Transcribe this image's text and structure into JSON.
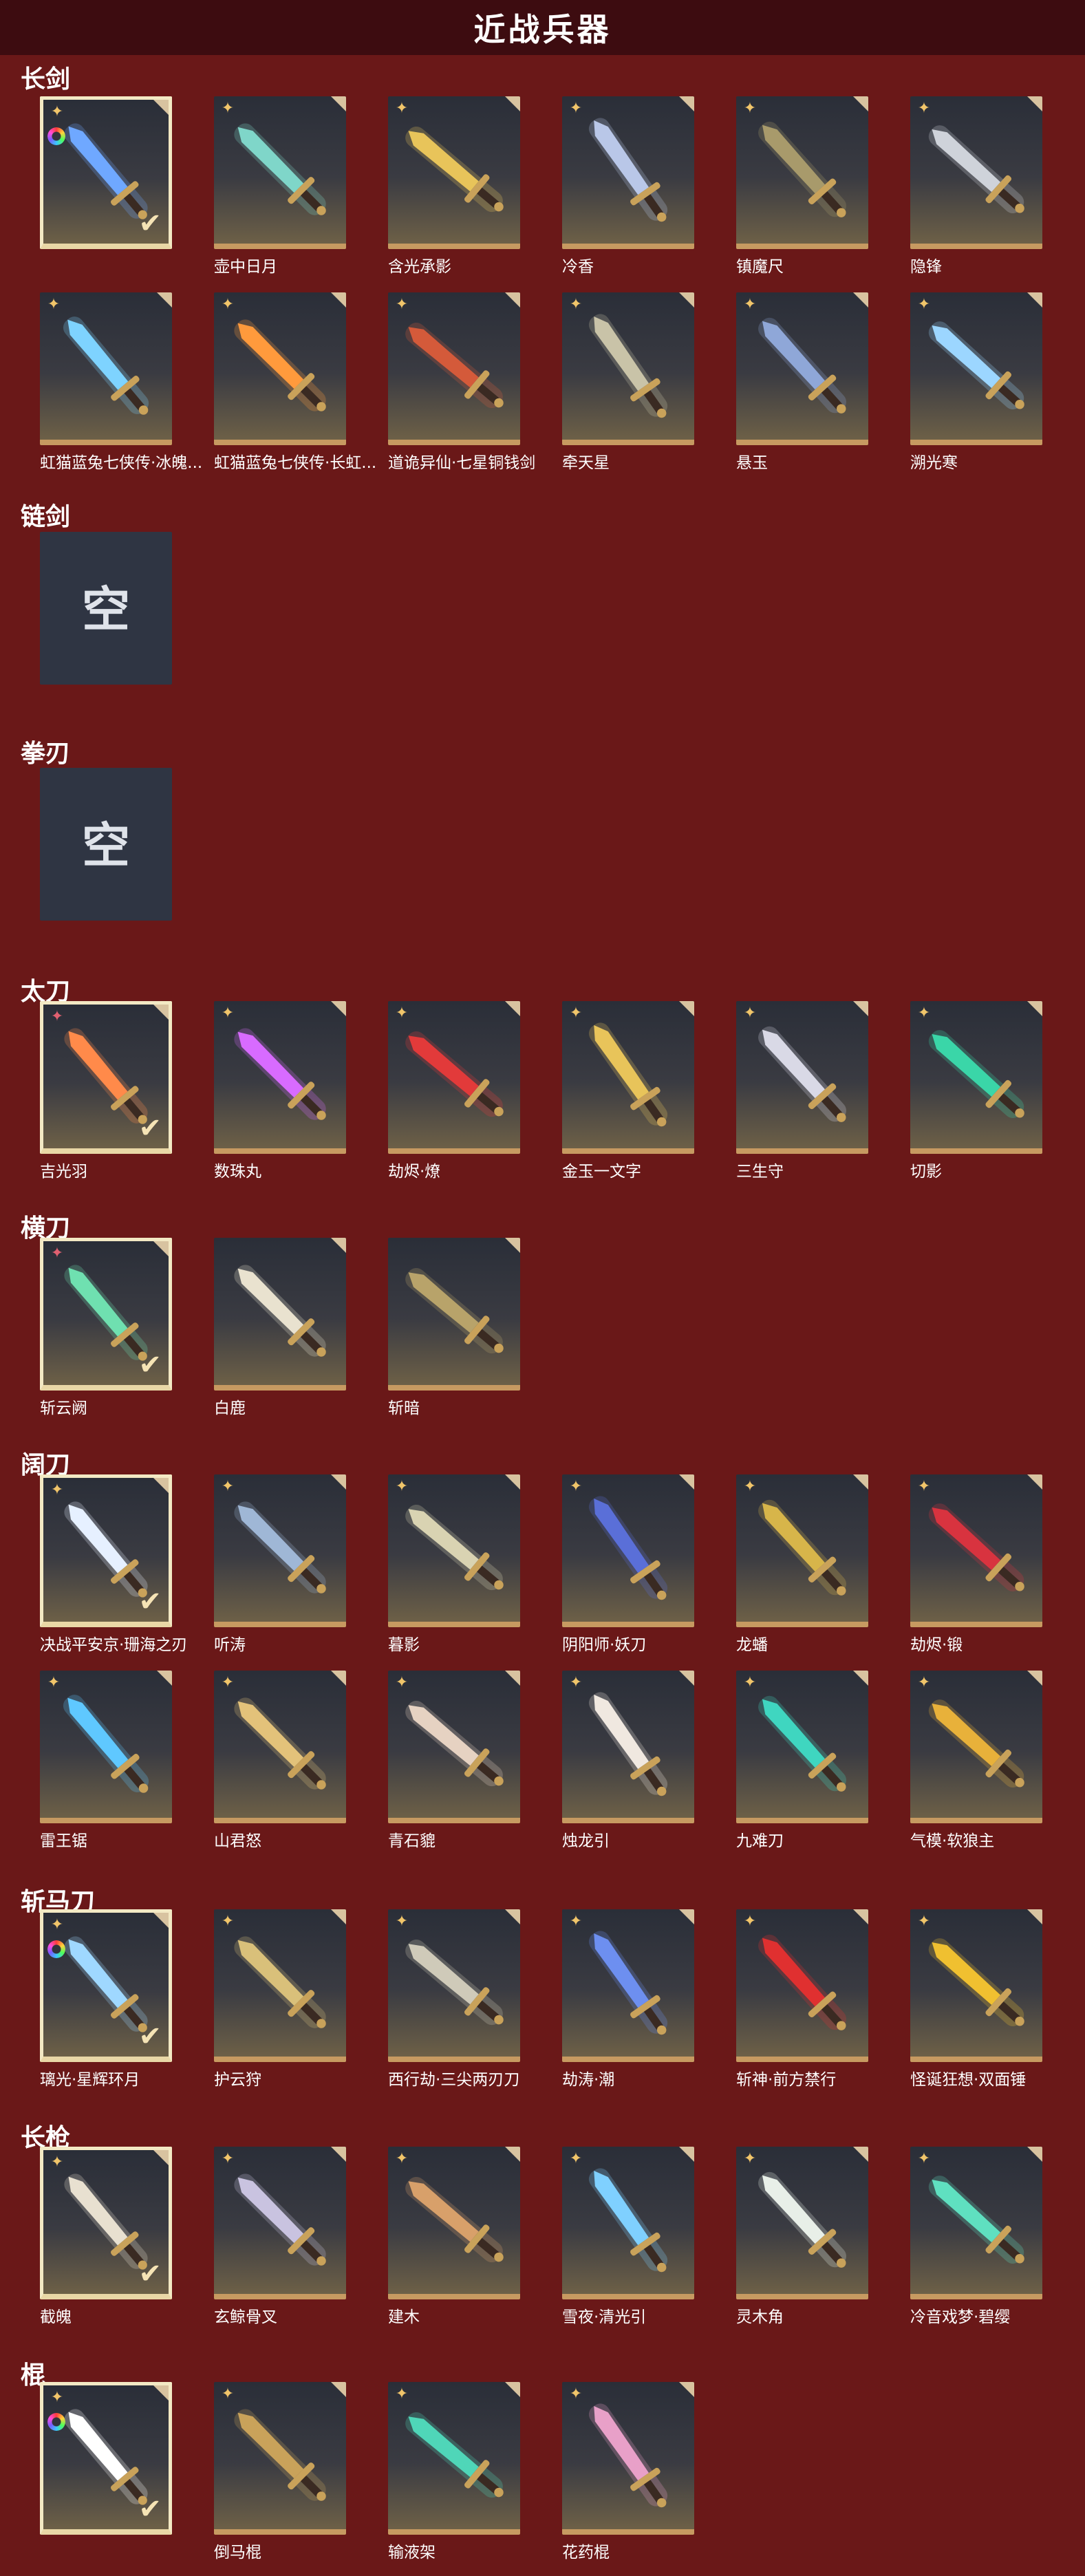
{
  "header": {
    "title": "近战兵器"
  },
  "categories": [
    {
      "title": "长剑",
      "items": [
        {
          "name": "",
          "rarity": "rainbow",
          "selected": true,
          "color": "#6fa8ff"
        },
        {
          "name": "壶中日月",
          "rarity": "gold",
          "color": "#7fd6c9"
        },
        {
          "name": "含光承影",
          "rarity": "gold",
          "color": "#e8c45a"
        },
        {
          "name": "冷香",
          "rarity": "gold",
          "color": "#b9c7e8"
        },
        {
          "name": "镇魔尺",
          "rarity": "gold",
          "color": "#a89a6b"
        },
        {
          "name": "隐锋",
          "rarity": "gold",
          "color": "#cfd3da"
        },
        {
          "name": "虹猫蓝兔七侠传·冰魄...",
          "rarity": "gold",
          "color": "#7ed3ff"
        },
        {
          "name": "虹猫蓝兔七侠传·长虹...",
          "rarity": "gold",
          "color": "#ff9a3c"
        },
        {
          "name": "道诡异仙·七星铜钱剑",
          "rarity": "gold",
          "color": "#d45a3a"
        },
        {
          "name": "牵天星",
          "rarity": "gold",
          "color": "#c9c3a8"
        },
        {
          "name": "悬玉",
          "rarity": "gold",
          "color": "#8fa7d8"
        },
        {
          "name": "溯光寒",
          "rarity": "gold",
          "color": "#9cd6ff"
        }
      ]
    },
    {
      "title": "链剑",
      "items": [
        {
          "name": "",
          "empty": true,
          "empty_label": "空"
        }
      ]
    },
    {
      "title": "拳刃",
      "items": [
        {
          "name": "",
          "empty": true,
          "empty_label": "空"
        }
      ]
    },
    {
      "title": "太刀",
      "items": [
        {
          "name": "吉光羽",
          "rarity": "red",
          "selected": true,
          "color": "#ff8a4a"
        },
        {
          "name": "数珠丸",
          "rarity": "gold",
          "color": "#d86bff"
        },
        {
          "name": "劫烬·燎",
          "rarity": "gold",
          "color": "#e23a3a"
        },
        {
          "name": "金玉一文字",
          "rarity": "gold",
          "color": "#e8c45a"
        },
        {
          "name": "三生守",
          "rarity": "gold",
          "color": "#d9d9e6"
        },
        {
          "name": "切影",
          "rarity": "gold",
          "color": "#3ad6a8"
        }
      ]
    },
    {
      "title": "横刀",
      "items": [
        {
          "name": "斩云阙",
          "rarity": "red",
          "selected": true,
          "color": "#6fe0b0"
        },
        {
          "name": "白鹿",
          "rarity": "none",
          "color": "#e9e2cf"
        },
        {
          "name": "斩暗",
          "rarity": "none",
          "color": "#b8a36a"
        }
      ]
    },
    {
      "title": "阔刀",
      "items": [
        {
          "name": "决战平安京·珊海之刃",
          "rarity": "gold",
          "selected": true,
          "color": "#e6f0ff"
        },
        {
          "name": "听涛",
          "rarity": "gold",
          "color": "#9fb7d6"
        },
        {
          "name": "暮影",
          "rarity": "gold",
          "color": "#d9d3b2"
        },
        {
          "name": "阴阳师·妖刀",
          "rarity": "gold",
          "color": "#5a6fd8"
        },
        {
          "name": "龙蟠",
          "rarity": "gold",
          "color": "#d7b54a"
        },
        {
          "name": "劫烬·锻",
          "rarity": "gold",
          "color": "#d8333f"
        },
        {
          "name": "雷王锯",
          "rarity": "gold",
          "color": "#5fc8ff"
        },
        {
          "name": "山君怒",
          "rarity": "gold",
          "color": "#e3c27a"
        },
        {
          "name": "青石貔",
          "rarity": "gold",
          "color": "#e6d2c2"
        },
        {
          "name": "烛龙引",
          "rarity": "gold",
          "color": "#f0e8e0"
        },
        {
          "name": "九难刀",
          "rarity": "gold",
          "color": "#3fd6c0"
        },
        {
          "name": "气模·软狼主",
          "rarity": "gold",
          "color": "#e8b13a"
        }
      ]
    },
    {
      "title": "斩马刀",
      "items": [
        {
          "name": "璃光·星辉环月",
          "rarity": "rainbow",
          "selected": true,
          "color": "#9fd8ff"
        },
        {
          "name": "护云狩",
          "rarity": "gold",
          "color": "#d9c07a"
        },
        {
          "name": "西行劫·三尖两刃刀",
          "rarity": "gold",
          "color": "#cfcab9"
        },
        {
          "name": "劫涛·潮",
          "rarity": "gold",
          "color": "#6d8ff0"
        },
        {
          "name": "斩神·前方禁行",
          "rarity": "gold",
          "color": "#e03030"
        },
        {
          "name": "怪诞狂想·双面锤",
          "rarity": "gold",
          "color": "#f0c030"
        }
      ]
    },
    {
      "title": "长枪",
      "items": [
        {
          "name": "截魄",
          "rarity": "gold",
          "selected": true,
          "color": "#e8e0d0"
        },
        {
          "name": "玄鲸骨叉",
          "rarity": "gold",
          "color": "#c9c3e0"
        },
        {
          "name": "建木",
          "rarity": "gold",
          "color": "#d8a06a"
        },
        {
          "name": "雪夜·清光引",
          "rarity": "gold",
          "color": "#7fd0ff"
        },
        {
          "name": "灵木角",
          "rarity": "gold",
          "color": "#e8efe8"
        },
        {
          "name": "冷音戏梦·碧缨",
          "rarity": "gold",
          "color": "#5fe0c0"
        }
      ]
    },
    {
      "title": "棍",
      "items": [
        {
          "name": "",
          "rarity": "rainbow",
          "selected": true,
          "color": "#ffffff"
        },
        {
          "name": "倒马棍",
          "rarity": "gold",
          "color": "#c9a25a"
        },
        {
          "name": "输液架",
          "rarity": "gold",
          "color": "#4fd6b8"
        },
        {
          "name": "花药棍",
          "rarity": "gold",
          "color": "#e8a0c8"
        }
      ]
    }
  ],
  "icons": {
    "gold_badge": "sparkle-icon",
    "red_badge": "sparkle-icon",
    "rainbow": "rainbow-ring-icon",
    "check": "checkmark-icon"
  }
}
